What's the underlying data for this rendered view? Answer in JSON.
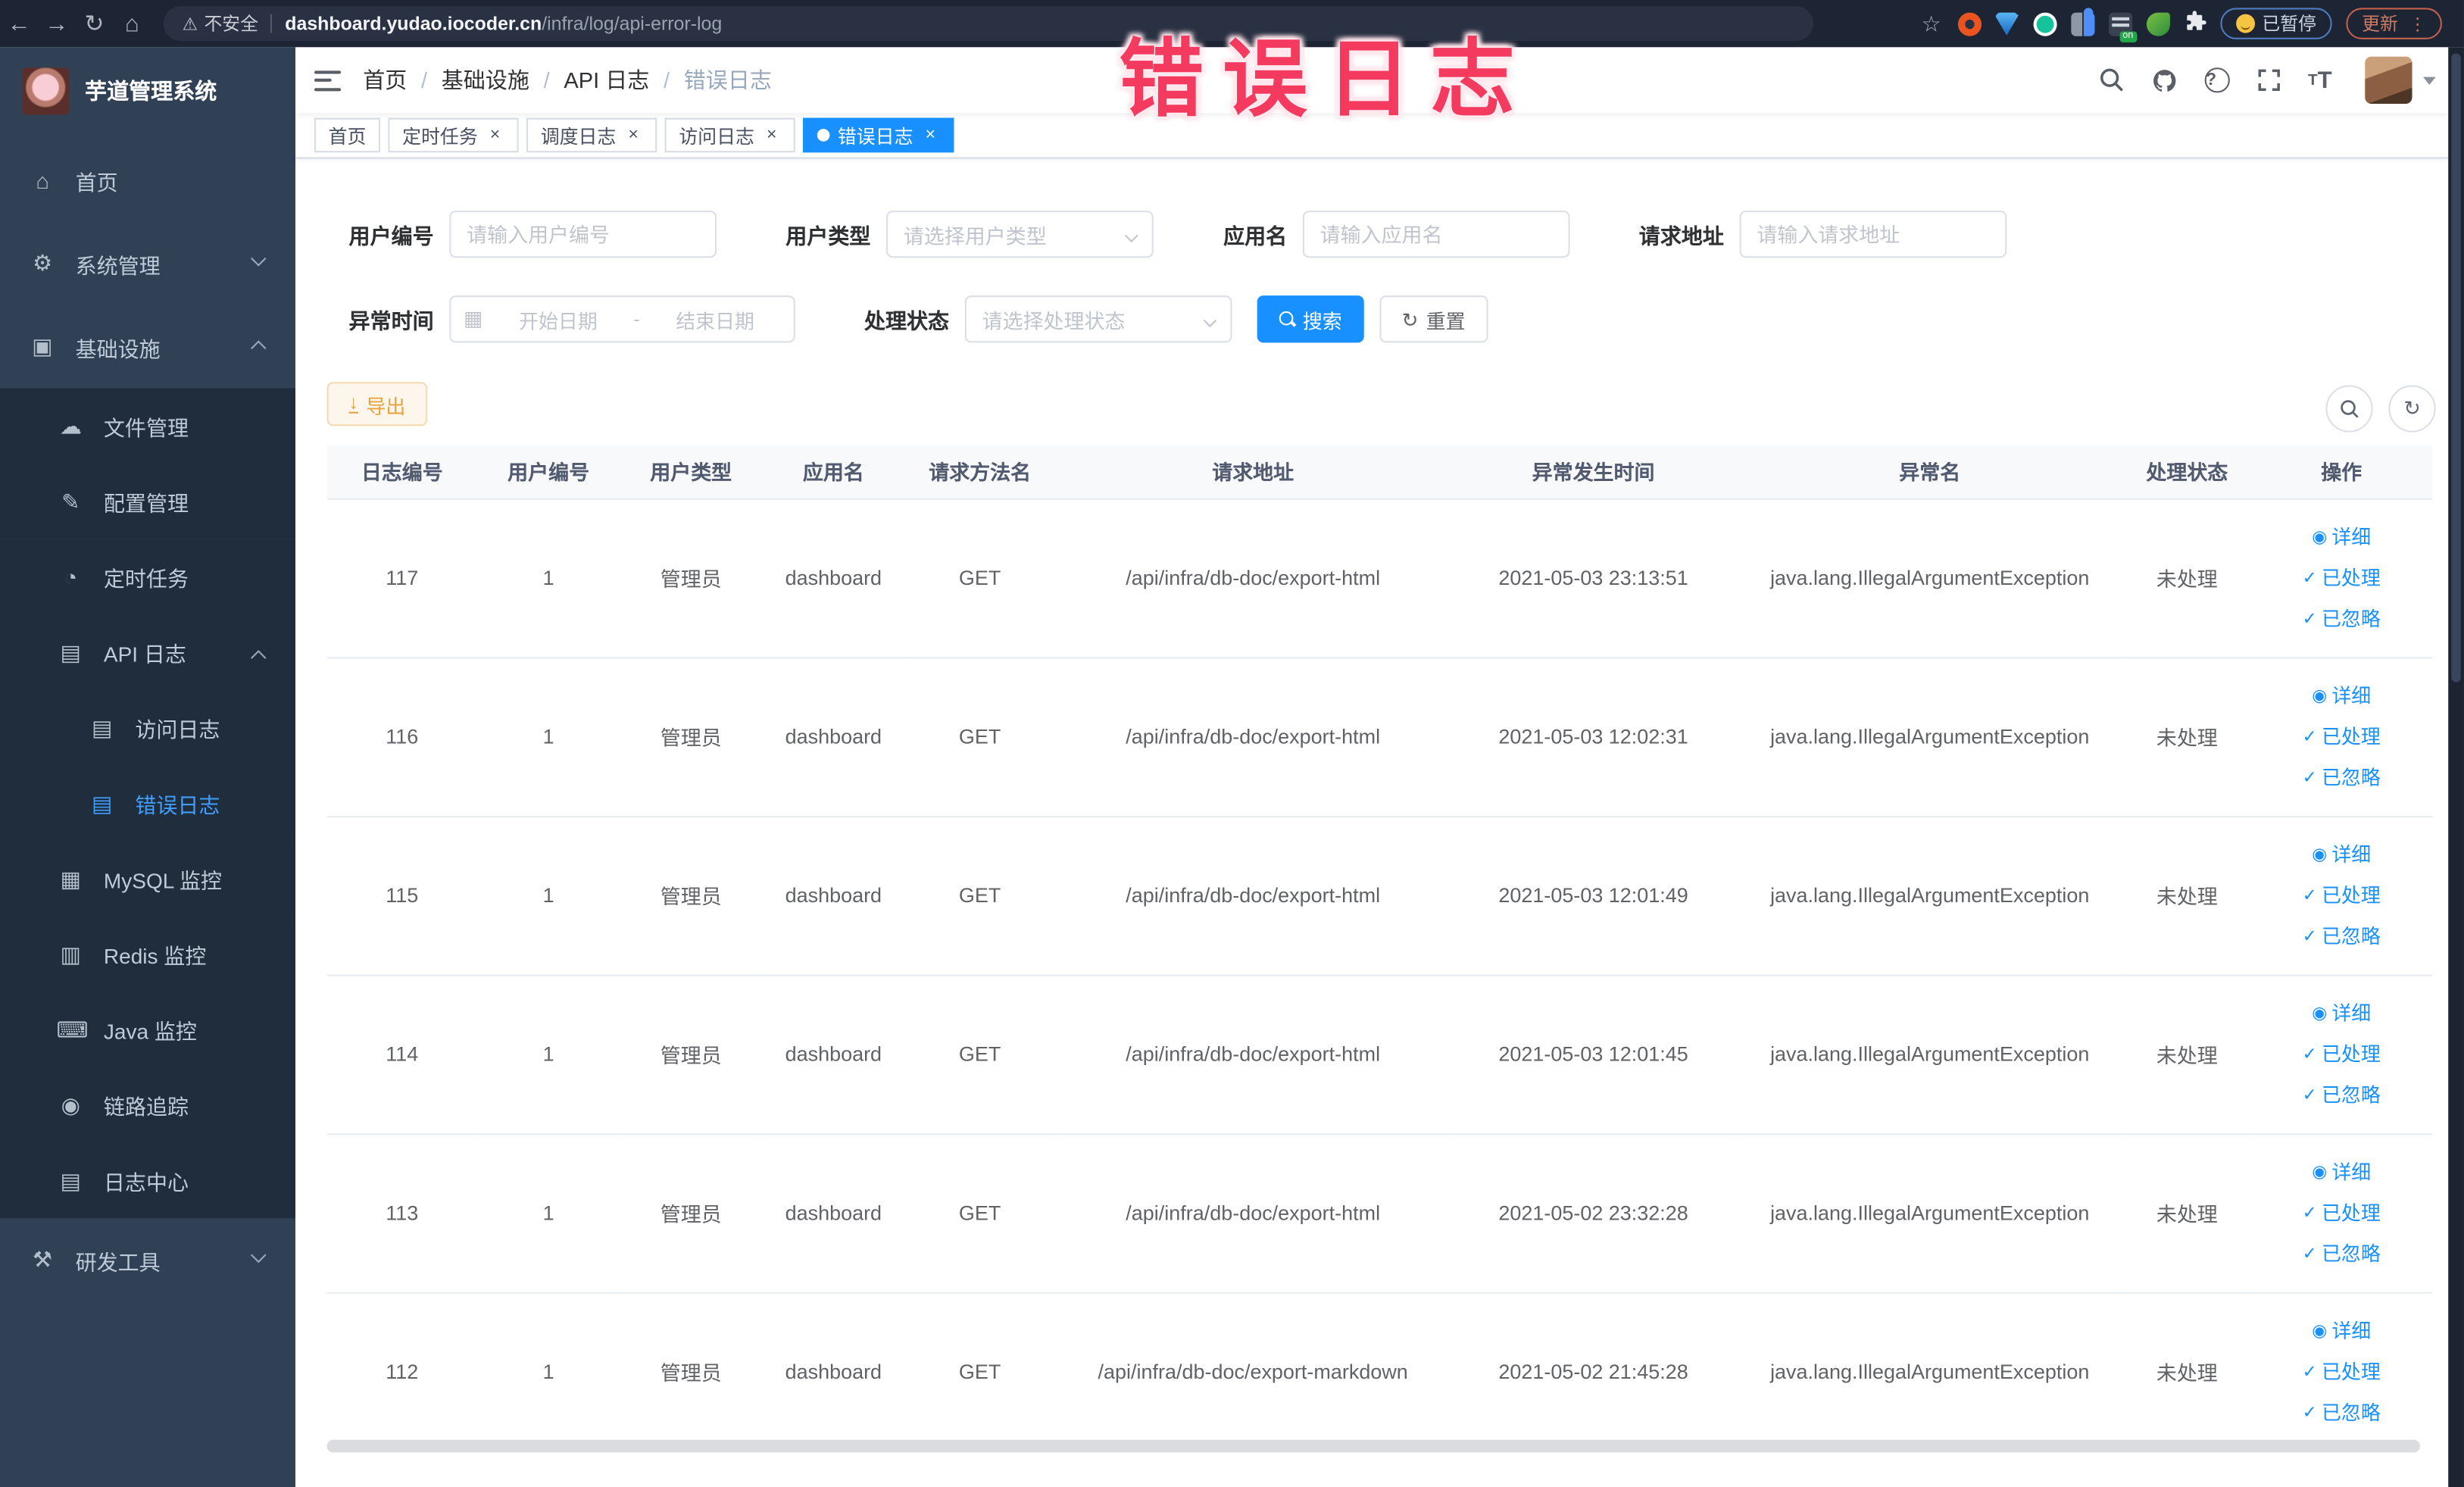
{
  "browser": {
    "security_label": "不安全",
    "url_domain": "dashboard.yudao.iocoder.cn",
    "url_path": "/infra/log/api-error-log",
    "paused_label": "已暂停",
    "update_label": "更新"
  },
  "annotation": {
    "text": "错误日志",
    "color": "#f43b5f"
  },
  "sidebar": {
    "logo_title": "芋道管理系统",
    "items": [
      {
        "key": "home",
        "label": "首页",
        "icon": "home-icon",
        "level": 0
      },
      {
        "key": "system-mgmt",
        "label": "系统管理",
        "icon": "gear-icon",
        "level": 0,
        "chevron": "down"
      },
      {
        "key": "infrastructure",
        "label": "基础设施",
        "icon": "infrastructure-icon",
        "level": 0,
        "chevron": "up"
      },
      {
        "key": "file-mgmt",
        "label": "文件管理",
        "icon": "cloud-upload-icon",
        "level": 1,
        "sub": true
      },
      {
        "key": "config-mgmt",
        "label": "配置管理",
        "icon": "edit-icon",
        "level": 1,
        "sub": true
      },
      {
        "key": "scheduled-tasks",
        "label": "定时任务",
        "icon": "timer-icon",
        "level": 1,
        "sub": true
      },
      {
        "key": "api-log",
        "label": "API 日志",
        "icon": "api-log-icon",
        "level": 1,
        "sub": true,
        "chevron": "up"
      },
      {
        "key": "access-log",
        "label": "访问日志",
        "icon": "access-log-icon",
        "level": 2,
        "sub": true
      },
      {
        "key": "error-log",
        "label": "错误日志",
        "icon": "error-log-icon",
        "level": 2,
        "sub": true,
        "active": true
      },
      {
        "key": "mysql-monitor",
        "label": "MySQL 监控",
        "icon": "mysql-icon",
        "level": 1,
        "sub": true
      },
      {
        "key": "redis-monitor",
        "label": "Redis 监控",
        "icon": "redis-icon",
        "level": 1,
        "sub": true
      },
      {
        "key": "java-monitor",
        "label": "Java 监控",
        "icon": "java-icon",
        "level": 1,
        "sub": true
      },
      {
        "key": "trace",
        "label": "链路追踪",
        "icon": "trace-icon",
        "level": 1,
        "sub": true
      },
      {
        "key": "log-center",
        "label": "日志中心",
        "icon": "log-center-icon",
        "level": 1,
        "sub": true
      },
      {
        "key": "dev-tools",
        "label": "研发工具",
        "icon": "toolbox-icon",
        "level": 0,
        "chevron": "down"
      }
    ]
  },
  "breadcrumb": {
    "items": [
      "首页",
      "基础设施",
      "API 日志",
      "错误日志"
    ]
  },
  "tabs": [
    {
      "label": "首页",
      "closable": false,
      "active": false
    },
    {
      "label": "定时任务",
      "closable": true,
      "active": false
    },
    {
      "label": "调度日志",
      "closable": true,
      "active": false
    },
    {
      "label": "访问日志",
      "closable": true,
      "active": false
    },
    {
      "label": "错误日志",
      "closable": true,
      "active": true
    }
  ],
  "filters": {
    "user_id": {
      "label": "用户编号",
      "placeholder": "请输入用户编号"
    },
    "user_type": {
      "label": "用户类型",
      "placeholder": "请选择用户类型"
    },
    "app_name": {
      "label": "应用名",
      "placeholder": "请输入应用名"
    },
    "request_url": {
      "label": "请求地址",
      "placeholder": "请输入请求地址"
    },
    "exception_time": {
      "label": "异常时间",
      "start_placeholder": "开始日期",
      "separator": "-",
      "end_placeholder": "结束日期"
    },
    "process_status": {
      "label": "处理状态",
      "placeholder": "请选择处理状态"
    },
    "search_label": "搜索",
    "reset_label": "重置"
  },
  "toolbar": {
    "export_label": "导出"
  },
  "table": {
    "columns": [
      "日志编号",
      "用户编号",
      "用户类型",
      "应用名",
      "请求方法名",
      "请求地址",
      "异常发生时间",
      "异常名",
      "处理状态",
      "操作"
    ],
    "rows": [
      {
        "log_id": "117",
        "user_id": "1",
        "user_type": "管理员",
        "app_name": "dashboard",
        "method": "GET",
        "request_url": "/api/infra/db-doc/export-html",
        "time": "2021-05-03 23:13:51",
        "exception": "java.lang.IllegalArgumentException",
        "status": "未处理"
      },
      {
        "log_id": "116",
        "user_id": "1",
        "user_type": "管理员",
        "app_name": "dashboard",
        "method": "GET",
        "request_url": "/api/infra/db-doc/export-html",
        "time": "2021-05-03 12:02:31",
        "exception": "java.lang.IllegalArgumentException",
        "status": "未处理"
      },
      {
        "log_id": "115",
        "user_id": "1",
        "user_type": "管理员",
        "app_name": "dashboard",
        "method": "GET",
        "request_url": "/api/infra/db-doc/export-html",
        "time": "2021-05-03 12:01:49",
        "exception": "java.lang.IllegalArgumentException",
        "status": "未处理"
      },
      {
        "log_id": "114",
        "user_id": "1",
        "user_type": "管理员",
        "app_name": "dashboard",
        "method": "GET",
        "request_url": "/api/infra/db-doc/export-html",
        "time": "2021-05-03 12:01:45",
        "exception": "java.lang.IllegalArgumentException",
        "status": "未处理"
      },
      {
        "log_id": "113",
        "user_id": "1",
        "user_type": "管理员",
        "app_name": "dashboard",
        "method": "GET",
        "request_url": "/api/infra/db-doc/export-html",
        "time": "2021-05-02 23:32:28",
        "exception": "java.lang.IllegalArgumentException",
        "status": "未处理"
      },
      {
        "log_id": "112",
        "user_id": "1",
        "user_type": "管理员",
        "app_name": "dashboard",
        "method": "GET",
        "request_url": "/api/infra/db-doc/export-markdown",
        "time": "2021-05-02 21:45:28",
        "exception": "java.lang.IllegalArgumentException",
        "status": "未处理"
      }
    ],
    "row_actions": [
      {
        "label": "详细",
        "icon": "eye-icon"
      },
      {
        "label": "已处理",
        "icon": "check-icon"
      },
      {
        "label": "已忽略",
        "icon": "check-icon"
      }
    ]
  }
}
